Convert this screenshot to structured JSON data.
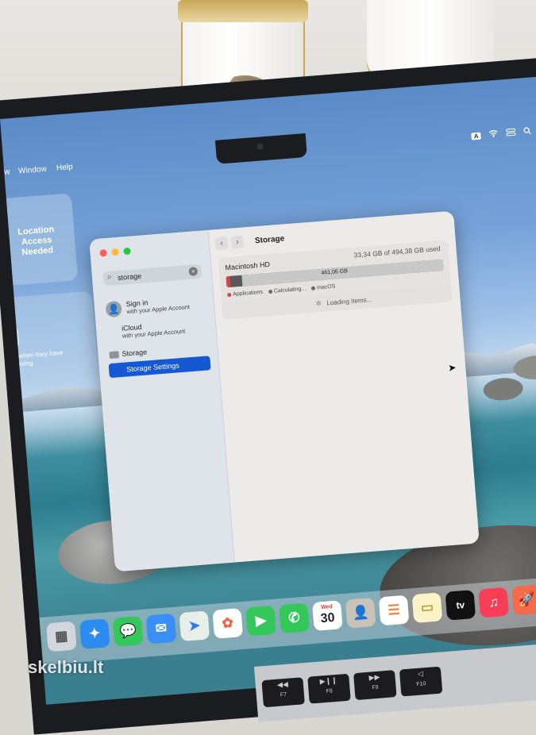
{
  "menubar": {
    "items": [
      "w",
      "Window",
      "Help"
    ],
    "input_badge": "A"
  },
  "widgets": {
    "location_title": "Location Access Needed",
    "location_note": "when they have",
    "location_note2": "essing"
  },
  "window": {
    "title": "Storage",
    "search": {
      "query": "storage"
    },
    "sidebar": {
      "sign_in_title": "Sign in",
      "sign_in_sub": "with your Apple Account",
      "icloud_title": "iCloud",
      "icloud_sub": "with your Apple Account",
      "section": "Storage",
      "selected_item": "Storage Settings"
    },
    "disk": {
      "name": "Macintosh HD",
      "usage": "33,34 GB of 494,38 GB used",
      "bar_label": "461,05 GB",
      "legend": [
        "Applications",
        "Calculating...",
        "macOS"
      ],
      "legend_colors": [
        "#d64540",
        "#6b6b6b",
        "#6b6b6b"
      ]
    },
    "loading_text": "Loading Items..."
  },
  "dock": {
    "calendar_month": "Wed",
    "calendar_day": "30",
    "apps": [
      "launchpad-icon",
      "safari-icon",
      "messages-icon",
      "mail-icon",
      "maps-icon",
      "photos-icon",
      "facetime-icon",
      "phone-icon",
      "calendar-icon",
      "contacts-icon",
      "reminders-icon",
      "notes-icon",
      "tv-icon",
      "music-icon",
      "rocket-icon",
      "app-store-icon"
    ],
    "tv_label": "tv"
  },
  "keyboard": {
    "keys": [
      {
        "glyph": "◀◀",
        "label": "F7"
      },
      {
        "glyph": "▶❙❙",
        "label": "F8"
      },
      {
        "glyph": "▶▶",
        "label": "F9"
      },
      {
        "glyph": "◁",
        "label": "F10"
      }
    ]
  },
  "watermark": "skelbiu.lt"
}
